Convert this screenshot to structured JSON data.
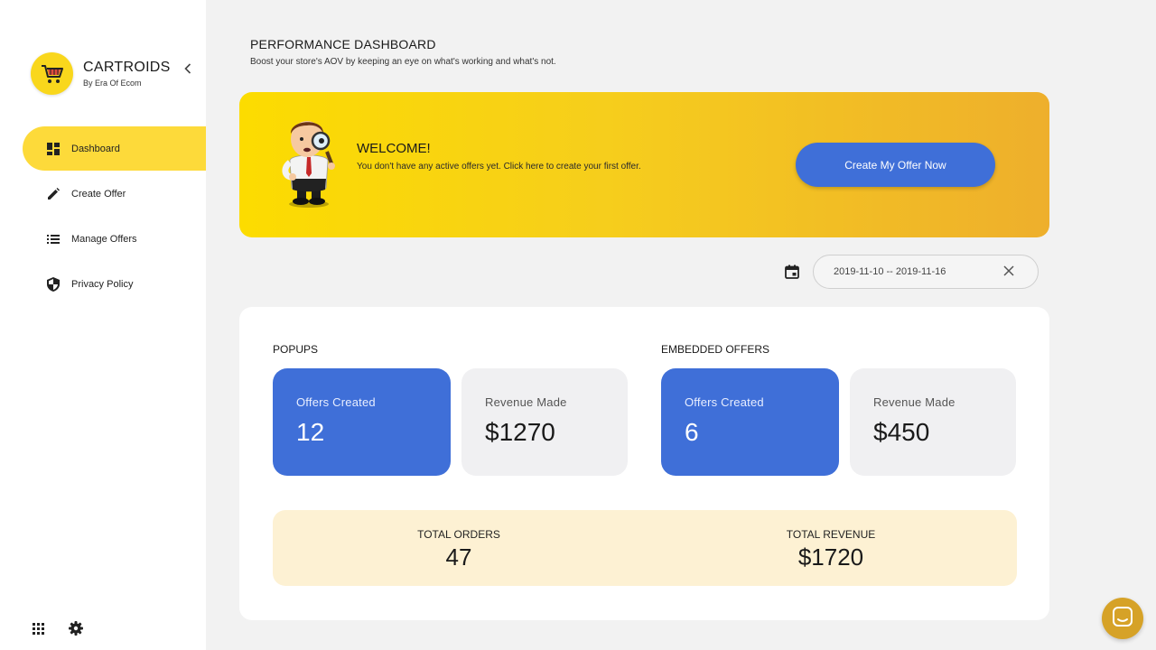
{
  "brand": {
    "name": "CARTROIDS",
    "subtitle": "By Era Of Ecom"
  },
  "sidebar": {
    "items": [
      {
        "label": "Dashboard",
        "icon": "dashboard-icon",
        "active": true
      },
      {
        "label": "Create Offer",
        "icon": "pencil-icon",
        "active": false
      },
      {
        "label": "Manage Offers",
        "icon": "list-icon",
        "active": false
      },
      {
        "label": "Privacy Policy",
        "icon": "shield-icon",
        "active": false
      }
    ],
    "bottom_icons": [
      "apps-grid-icon",
      "gear-icon"
    ]
  },
  "header": {
    "title": "PERFORMANCE DASHBOARD",
    "subtitle": "Boost your store's AOV by keeping an eye on what's working and what's not."
  },
  "banner": {
    "title": "WELCOME!",
    "text": "You don't have any active offers yet. Click here to create your first offer.",
    "cta_label": "Create My Offer Now"
  },
  "date_range": {
    "value": "2019-11-10 -- 2019-11-16"
  },
  "popups": {
    "label": "POPUPS",
    "offers_label": "Offers Created",
    "offers_value": "12",
    "revenue_label": "Revenue Made",
    "revenue_value": "$1270"
  },
  "embedded": {
    "label": "EMBEDDED OFFERS",
    "offers_label": "Offers Created",
    "offers_value": "6",
    "revenue_label": "Revenue Made",
    "revenue_value": "$450"
  },
  "totals": {
    "orders_label": "TOTAL ORDERS",
    "orders_value": "47",
    "revenue_label": "TOTAL REVENUE",
    "revenue_value": "$1720"
  },
  "colors": {
    "accent_yellow": "#fdda3a",
    "primary_blue": "#3f6fd8",
    "totals_bg": "#fdf1d3",
    "chat_button": "#d6a227"
  }
}
